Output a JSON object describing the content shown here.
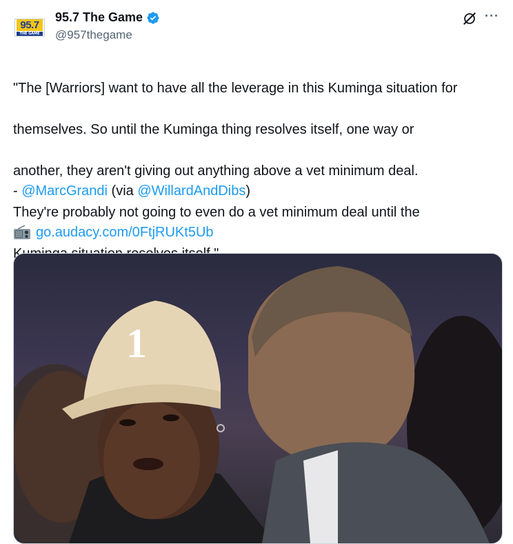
{
  "account": {
    "avatar_number": "95.7",
    "avatar_subtext": "THE GAME",
    "display_name": "95.7 The Game",
    "handle": "@957thegame",
    "verified": true
  },
  "actions": {
    "grok_icon": "grok-icon",
    "more_label": "···"
  },
  "tweet": {
    "quote_lines": [
      "\"The [Warriors] want to have all the leverage in this Kuminga situation for",
      "themselves. So until the Kuminga thing resolves itself, one way or",
      "another, they aren't giving out anything above a vet minimum deal.",
      "They're probably not going to even do a vet minimum deal until the",
      "Kuminga situation resolves itself.\""
    ],
    "attribution_prefix": "- ",
    "attribution_mention": "@MarcGrandi",
    "attribution_via": " (via ",
    "attribution_via_mention": "@WillardAndDibs",
    "attribution_suffix": ")",
    "link_icon": "radio-icon",
    "link": "go.audacy.com/0FtjRUKt5Ub"
  },
  "media": {
    "cap_number": "1"
  },
  "colors": {
    "link": "#1d9bf0",
    "verified": "#1d9bf0",
    "secondary_text": "#536471"
  }
}
